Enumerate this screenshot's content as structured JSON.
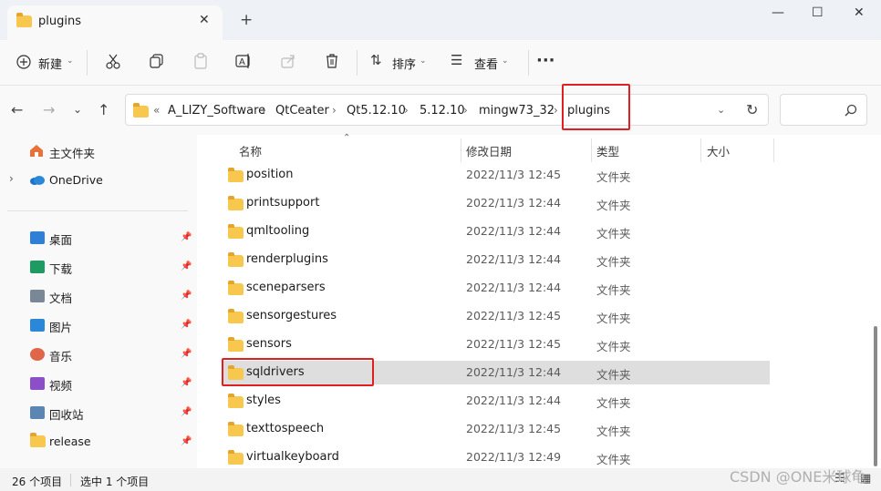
{
  "window": {
    "tab_title": "plugins",
    "tab_close": "✕",
    "new_tab": "+",
    "minimize": "—",
    "maximize": "☐",
    "close": "✕"
  },
  "toolbar": {
    "new_label": "新建",
    "sort_label": "排序",
    "view_label": "查看",
    "more": "···"
  },
  "address": {
    "overflow": "«",
    "crumbs": [
      "A_LIZY_Software",
      "QtCeater",
      "Qt5.12.10",
      "5.12.10",
      "mingw73_32",
      "plugins"
    ],
    "separator": "›",
    "search_placeholder": ""
  },
  "sidebar": {
    "home": "主文件夹",
    "onedrive": "OneDrive",
    "quick": [
      {
        "label": "桌面",
        "icon": "desktop-icon",
        "color": "#2f7fd6"
      },
      {
        "label": "下载",
        "icon": "download-icon",
        "color": "#1e9b63"
      },
      {
        "label": "文档",
        "icon": "document-icon",
        "color": "#7a8797"
      },
      {
        "label": "图片",
        "icon": "pictures-icon",
        "color": "#2b88d8"
      },
      {
        "label": "音乐",
        "icon": "music-icon",
        "color": "#e0664a"
      },
      {
        "label": "视频",
        "icon": "video-icon",
        "color": "#8b4fc7"
      },
      {
        "label": "回收站",
        "icon": "recycle-bin-icon",
        "color": "#5b86b3"
      },
      {
        "label": "release",
        "icon": "folder-icon",
        "color": "#f7c74e"
      }
    ]
  },
  "columns": {
    "name": "名称",
    "date": "修改日期",
    "type": "类型",
    "size": "大小"
  },
  "files": [
    {
      "name": "position",
      "date": "2022/11/3 12:45",
      "type": "文件夹"
    },
    {
      "name": "printsupport",
      "date": "2022/11/3 12:44",
      "type": "文件夹"
    },
    {
      "name": "qmltooling",
      "date": "2022/11/3 12:44",
      "type": "文件夹"
    },
    {
      "name": "renderplugins",
      "date": "2022/11/3 12:44",
      "type": "文件夹"
    },
    {
      "name": "sceneparsers",
      "date": "2022/11/3 12:44",
      "type": "文件夹"
    },
    {
      "name": "sensorgestures",
      "date": "2022/11/3 12:45",
      "type": "文件夹"
    },
    {
      "name": "sensors",
      "date": "2022/11/3 12:45",
      "type": "文件夹"
    },
    {
      "name": "sqldrivers",
      "date": "2022/11/3 12:44",
      "type": "文件夹",
      "selected": true
    },
    {
      "name": "styles",
      "date": "2022/11/3 12:44",
      "type": "文件夹"
    },
    {
      "name": "texttospeech",
      "date": "2022/11/3 12:45",
      "type": "文件夹"
    },
    {
      "name": "virtualkeyboard",
      "date": "2022/11/3 12:49",
      "type": "文件夹"
    }
  ],
  "status": {
    "count": "26 个项目",
    "selected": "选中 1 个项目"
  },
  "watermark": "CSDN @ONE米球龟",
  "colors": {
    "accent": "#0067c0",
    "highlight": "#e02020",
    "folder": "#f7c74e",
    "selection": "#dedede"
  }
}
